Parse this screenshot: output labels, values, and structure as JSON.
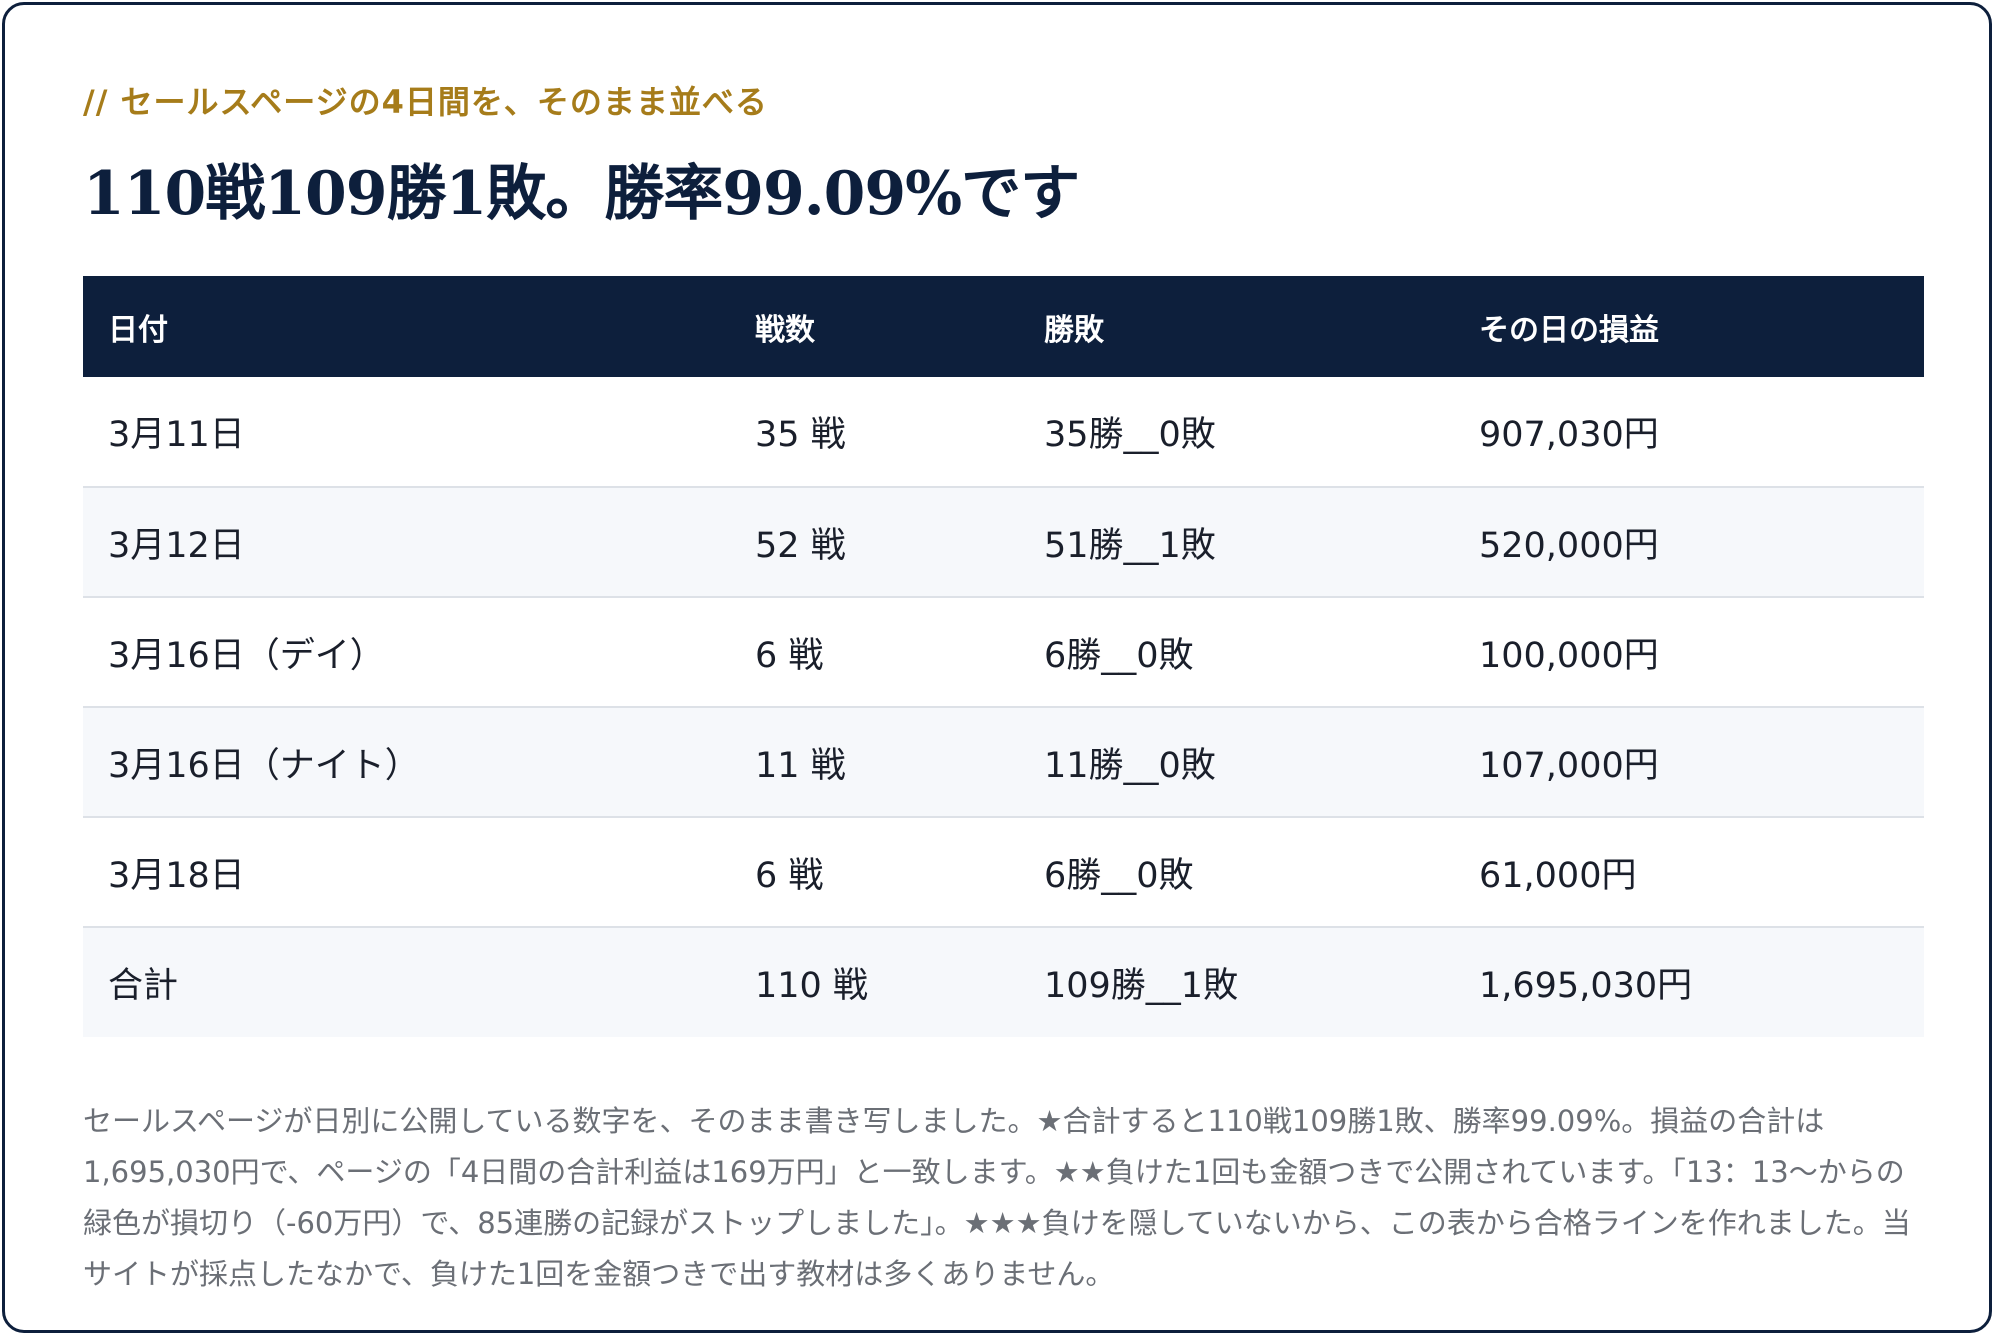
{
  "eyebrow": "// セールスページの4日間を、そのまま並べる",
  "heading": "110戦109勝1敗。勝率99.09%です",
  "table": {
    "headers": [
      "日付",
      "戦数",
      "勝敗",
      "その日の損益"
    ],
    "rows": [
      {
        "date": "3月11日",
        "count": "35 戦",
        "result": "35勝__0敗",
        "pl": "907,030円"
      },
      {
        "date": "3月12日",
        "count": "52 戦",
        "result": "51勝__1敗",
        "pl": "520,000円"
      },
      {
        "date": "3月16日（デイ）",
        "count": "6 戦",
        "result": "6勝__0敗",
        "pl": "100,000円"
      },
      {
        "date": "3月16日（ナイト）",
        "count": "11 戦",
        "result": "11勝__0敗",
        "pl": "107,000円"
      },
      {
        "date": "3月18日",
        "count": "6 戦",
        "result": "6勝__0敗",
        "pl": "61,000円"
      },
      {
        "date": "合計",
        "count": "110 戦",
        "result": "109勝__1敗",
        "pl": "1,695,030円"
      }
    ]
  },
  "note": "セールスページが日別に公開している数字を、そのまま書き写しました。★合計すると110戦109勝1敗、勝率99.09%。損益の合計は1,695,030円で、ページの「4日間の合計利益は169万円」と一致します。★★負けた1回も金額つきで公開されています。「13：13〜からの緑色が損切り（-60万円）で、85連勝の記録がストップしました」。★★★負けを隠していないから、この表から合格ラインを作れました。当サイトが採点したなかで、負けた1回を金額つきで出す教材は多くありません。"
}
